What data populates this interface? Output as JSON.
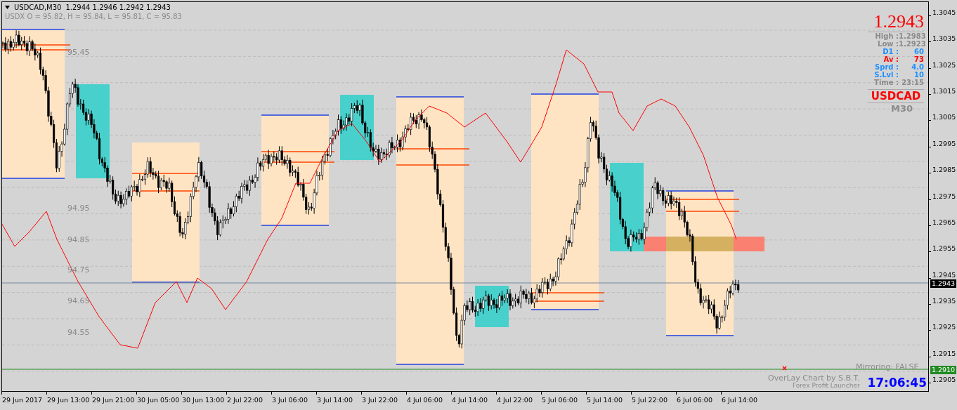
{
  "header": {
    "symbol": "USDCAD,M30",
    "ohlc": "1.2944 1.2946 1.2942 1.2943",
    "overlay_line": "USDX O = 95.82, H = 95.84, L = 95.81, C = 95.83"
  },
  "overlay_labels": [
    "95.45",
    "94.95",
    "94.85",
    "94.75",
    "94.65",
    "94.55"
  ],
  "info_panel": {
    "price": "1.2943",
    "rows": [
      {
        "label": "High :",
        "value": "1.2983",
        "kind": "faint"
      },
      {
        "label": "Low :",
        "value": "1.2923",
        "kind": "faint"
      },
      {
        "label": "D1 :",
        "value": "60",
        "kind": "blue"
      },
      {
        "label": "Av :",
        "value": "73",
        "kind": "red"
      },
      {
        "label": "Sprd :",
        "value": "4.0",
        "kind": "blue"
      },
      {
        "label": "S.Lvl :",
        "value": "10",
        "kind": "blue"
      },
      {
        "label": "Time :",
        "value": "23:15",
        "kind": "faint"
      }
    ],
    "symbol": "USDCAD",
    "timeframe": "M30"
  },
  "price_axis": {
    "ticks": [
      "1.3045",
      "1.3035",
      "1.3025",
      "1.3015",
      "1.3005",
      "1.2995",
      "1.2985",
      "1.2975",
      "1.2965",
      "1.2955",
      "1.2945",
      "1.2935",
      "1.2925",
      "1.2915",
      "1.2905"
    ],
    "current_price": "1.2943",
    "marker_price": "1.2910"
  },
  "time_axis": [
    "29 Jun 2017",
    "29 Jun 13:00",
    "29 Jun 21:00",
    "30 Jun 05:00",
    "30 Jun 13:00",
    "2 Jul 22:00",
    "3 Jul 06:00",
    "3 Jul 14:00",
    "3 Jul 22:00",
    "4 Jul 06:00",
    "4 Jul 14:00",
    "4 Jul 22:00",
    "5 Jul 06:00",
    "5 Jul 14:00",
    "5 Jul 22:00",
    "6 Jul 06:00",
    "6 Jul 14:00"
  ],
  "footer": {
    "mirroring": "Mirroring: FALSE",
    "credit": "OverLay Chart by S.B.T.",
    "product": "Forex Profit Launcher",
    "clock": "17:06:45"
  }
}
